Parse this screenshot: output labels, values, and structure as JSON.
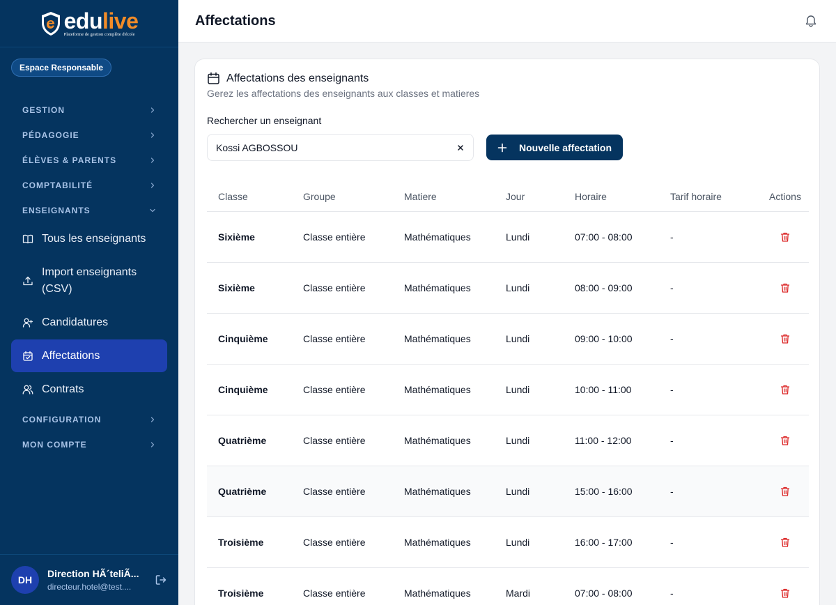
{
  "brand": {
    "word_a": "edu",
    "word_b": "live",
    "tagline": "Plateforme de gestion  complète d'école"
  },
  "space_badge": "Espace Responsable",
  "nav": {
    "gestion": "GESTION",
    "pedagogie": "PÉDAGOGIE",
    "eleves": "ÉLÈVES & PARENTS",
    "comptabilite": "COMPTABILITÉ",
    "enseignants": "ENSEIGNANTS",
    "enseignants_items": {
      "tous": "Tous les enseignants",
      "import_l1": "Import enseignants",
      "import_l2": "(CSV)",
      "candidatures": "Candidatures",
      "affectations": "Affectations",
      "contrats": "Contrats"
    },
    "configuration": "CONFIGURATION",
    "mon_compte": "MON COMPTE"
  },
  "user": {
    "initials": "DH",
    "name": "Direction HÃ´teliÃ...",
    "email": "directeur.hotel@test...."
  },
  "header": {
    "title": "Affectations"
  },
  "card": {
    "title": "Affectations des enseignants",
    "subtitle": "Gerez les affectations des enseignants aux classes et matieres",
    "search_label": "Rechercher un enseignant",
    "search_value": "Kossi AGBOSSOU",
    "new_button": "Nouvelle affectation"
  },
  "table": {
    "headers": {
      "classe": "Classe",
      "groupe": "Groupe",
      "matiere": "Matiere",
      "jour": "Jour",
      "horaire": "Horaire",
      "tarif": "Tarif horaire",
      "actions": "Actions"
    },
    "rows": [
      {
        "classe": "Sixième",
        "groupe": "Classe entière",
        "matiere": "Mathématiques",
        "jour": "Lundi",
        "horaire": "07:00 - 08:00",
        "tarif": "-"
      },
      {
        "classe": "Sixième",
        "groupe": "Classe entière",
        "matiere": "Mathématiques",
        "jour": "Lundi",
        "horaire": "08:00 - 09:00",
        "tarif": "-"
      },
      {
        "classe": "Cinquième",
        "groupe": "Classe entière",
        "matiere": "Mathématiques",
        "jour": "Lundi",
        "horaire": "09:00 - 10:00",
        "tarif": "-"
      },
      {
        "classe": "Cinquième",
        "groupe": "Classe entière",
        "matiere": "Mathématiques",
        "jour": "Lundi",
        "horaire": "10:00 - 11:00",
        "tarif": "-"
      },
      {
        "classe": "Quatrième",
        "groupe": "Classe entière",
        "matiere": "Mathématiques",
        "jour": "Lundi",
        "horaire": "11:00 - 12:00",
        "tarif": "-"
      },
      {
        "classe": "Quatrième",
        "groupe": "Classe entière",
        "matiere": "Mathématiques",
        "jour": "Lundi",
        "horaire": "15:00 - 16:00",
        "tarif": "-"
      },
      {
        "classe": "Troisième",
        "groupe": "Classe entière",
        "matiere": "Mathématiques",
        "jour": "Lundi",
        "horaire": "16:00 - 17:00",
        "tarif": "-"
      },
      {
        "classe": "Troisième",
        "groupe": "Classe entière",
        "matiere": "Mathématiques",
        "jour": "Mardi",
        "horaire": "07:00 - 08:00",
        "tarif": "-"
      }
    ]
  }
}
